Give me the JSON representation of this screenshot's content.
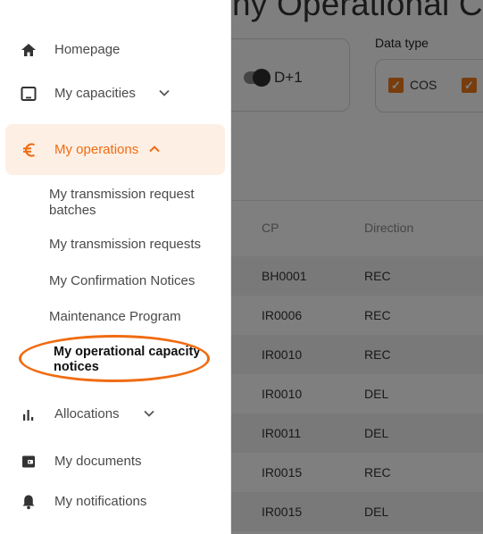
{
  "main": {
    "page_title": "ny Operational Cap",
    "toggle_label": "D+1",
    "data_type_label": "Data type",
    "data_type_options": [
      {
        "label": "COS",
        "checked": true
      },
      {
        "label": "",
        "checked": true
      }
    ],
    "table": {
      "headers": [
        "CP",
        "Direction"
      ],
      "rows": [
        {
          "cp": "BH0001",
          "direction": "REC"
        },
        {
          "cp": "IR0006",
          "direction": "REC"
        },
        {
          "cp": "IR0010",
          "direction": "REC"
        },
        {
          "cp": "IR0010",
          "direction": "DEL"
        },
        {
          "cp": "IR0011",
          "direction": "DEL"
        },
        {
          "cp": "IR0015",
          "direction": "REC"
        },
        {
          "cp": "IR0015",
          "direction": "DEL"
        }
      ]
    }
  },
  "sidebar": {
    "items": [
      {
        "label": "Homepage",
        "icon": "home-icon"
      },
      {
        "label": "My capacities",
        "icon": "tablet-icon",
        "expandable": true
      },
      {
        "label": "My operations",
        "icon": "euro-icon",
        "expanded": true,
        "active": true
      },
      {
        "label": "Allocations",
        "icon": "bar-chart-icon",
        "expandable": true
      },
      {
        "label": "My documents",
        "icon": "wallet-icon"
      },
      {
        "label": "My notifications",
        "icon": "bell-icon"
      }
    ],
    "sub_items": [
      {
        "label": "My transmission request batches"
      },
      {
        "label": "My transmission requests"
      },
      {
        "label": "My Confirmation Notices"
      },
      {
        "label": "Maintenance Program"
      },
      {
        "label": "My operational capacity notices",
        "current": true
      }
    ]
  },
  "colors": {
    "accent": "#ef6c12",
    "active_bg": "#fdefe4",
    "overlay": "rgba(0,0,0,0.5)"
  }
}
